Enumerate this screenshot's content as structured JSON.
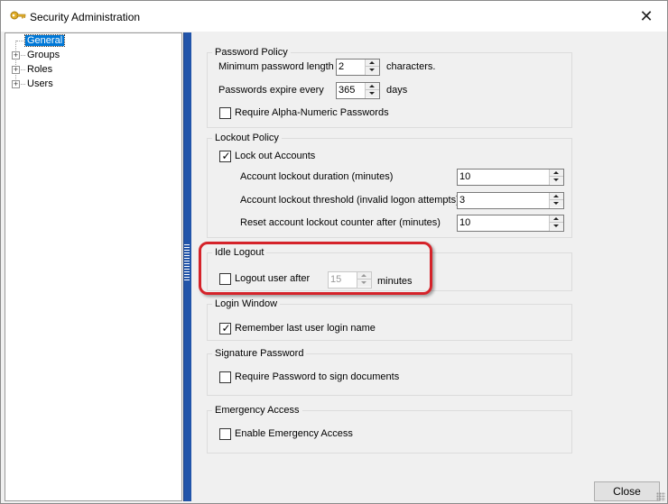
{
  "window": {
    "title": "Security Administration",
    "close_glyph": "✕",
    "icon": "key-icon"
  },
  "tree": {
    "items": [
      {
        "label": "General",
        "expandable": false,
        "selected": true
      },
      {
        "label": "Groups",
        "expandable": true,
        "selected": false
      },
      {
        "label": "Roles",
        "expandable": true,
        "selected": false
      },
      {
        "label": "Users",
        "expandable": true,
        "selected": false
      }
    ],
    "expander_glyph": "+"
  },
  "password_policy": {
    "title": "Password Policy",
    "min_length_label": "Minimum password length",
    "min_length_value": "2",
    "min_length_unit": "characters.",
    "expire_label": "Passwords expire every",
    "expire_value": "365",
    "expire_unit": "days",
    "alnum_label": "Require Alpha-Numeric Passwords",
    "alnum_checked": false
  },
  "lockout_policy": {
    "title": "Lockout Policy",
    "lockout_label": "Lock out Accounts",
    "lockout_checked": true,
    "duration_label": "Account lockout duration (minutes)",
    "duration_value": "10",
    "threshold_label": "Account lockout threshold (invalid logon attempts)",
    "threshold_value": "3",
    "reset_label": "Reset account lockout counter after (minutes)",
    "reset_value": "10"
  },
  "idle_logout": {
    "title": "Idle Logout",
    "logout_label": "Logout user after",
    "logout_checked": false,
    "minutes_value": "15",
    "minutes_unit": "minutes"
  },
  "login_window": {
    "title": "Login Window",
    "remember_label": "Remember last user login name",
    "remember_checked": true
  },
  "signature_password": {
    "title": "Signature Password",
    "require_label": "Require Password to sign documents",
    "require_checked": false
  },
  "emergency_access": {
    "title": "Emergency Access",
    "enable_label": "Enable Emergency Access",
    "enable_checked": false
  },
  "footer": {
    "close_label": "Close"
  },
  "colors": {
    "selection": "#0078d7",
    "splitter": "#2255aa",
    "highlight": "#d5232a"
  },
  "check_glyph": "✓"
}
